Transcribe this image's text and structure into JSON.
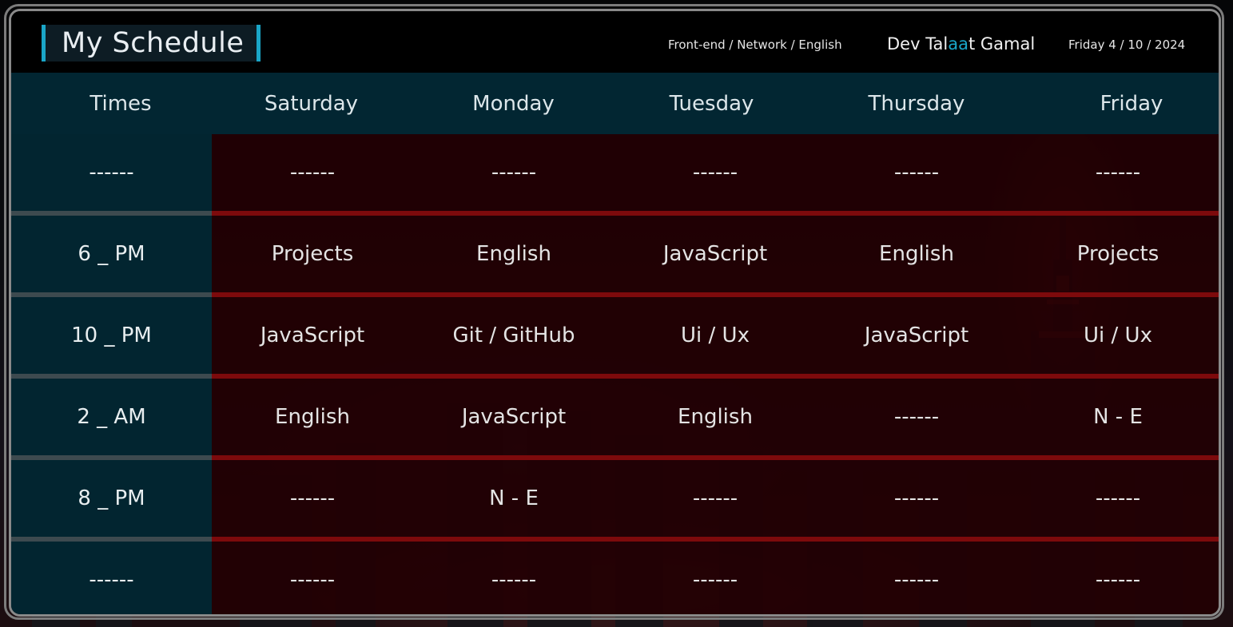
{
  "header": {
    "title": "My Schedule",
    "tracks": "Front-end / Network / English",
    "name_prefix": "Dev Tal",
    "name_highlight": "aa",
    "name_suffix": "t Gamal",
    "date": "Friday 4 / 10 / 2024"
  },
  "colors": {
    "accent": "#1aa6c8",
    "header_row_bg": "#02283a",
    "body_bg": "#280004",
    "row_separator": "#7d0a0c"
  },
  "table": {
    "columns": [
      "Times",
      "Saturday",
      "Monday",
      "Tuesday",
      "Thursday",
      "Friday"
    ],
    "rows": [
      {
        "time": "------",
        "cells": [
          "------",
          "------",
          "------",
          "------",
          "------"
        ]
      },
      {
        "time": "6 _ PM",
        "cells": [
          "Projects",
          "English",
          "JavaScript",
          "English",
          "Projects"
        ]
      },
      {
        "time": "10 _ PM",
        "cells": [
          "JavaScript",
          "Git / GitHub",
          "Ui / Ux",
          "JavaScript",
          "Ui / Ux"
        ]
      },
      {
        "time": "2 _ AM",
        "cells": [
          "English",
          "JavaScript",
          "English",
          "------",
          "N - E"
        ]
      },
      {
        "time": "8 _ PM",
        "cells": [
          "------",
          "N - E",
          "------",
          "------",
          "------"
        ]
      },
      {
        "time": "------",
        "cells": [
          "------",
          "------",
          "------",
          "------",
          "------"
        ]
      }
    ]
  }
}
